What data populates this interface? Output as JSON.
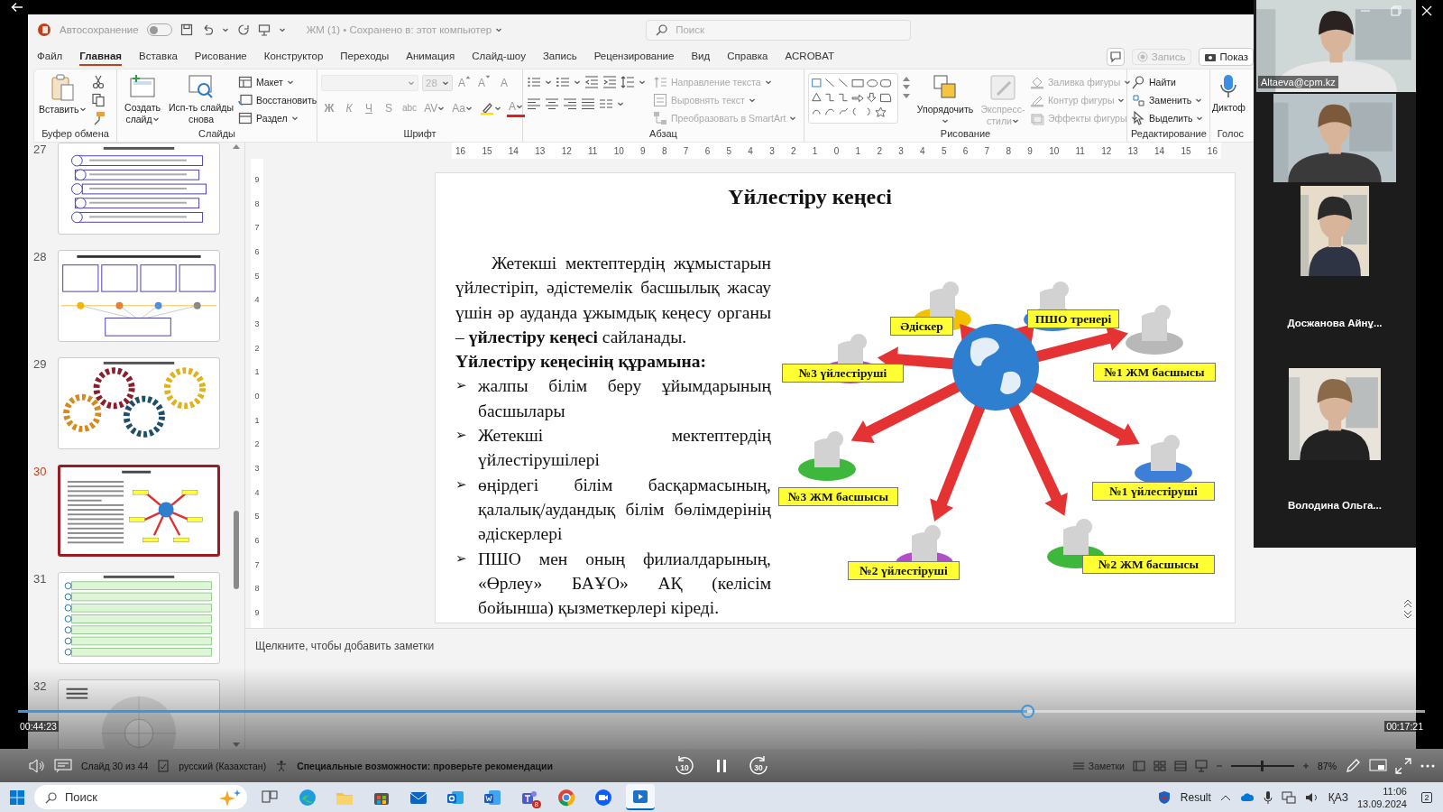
{
  "title_bar": {
    "autosave_label": "Автосохранение",
    "autosave_on": false,
    "document": "ЖМ (1) • Сохранено в: этот компьютер",
    "search_placeholder": "Поиск"
  },
  "ribbon_tabs": [
    {
      "label": "Файл",
      "selected": false
    },
    {
      "label": "Главная",
      "selected": true
    },
    {
      "label": "Вставка",
      "selected": false
    },
    {
      "label": "Рисование",
      "selected": false
    },
    {
      "label": "Конструктор",
      "selected": false
    },
    {
      "label": "Переходы",
      "selected": false
    },
    {
      "label": "Анимация",
      "selected": false
    },
    {
      "label": "Слайд-шоу",
      "selected": false
    },
    {
      "label": "Запись",
      "selected": false
    },
    {
      "label": "Рецензирование",
      "selected": false
    },
    {
      "label": "Вид",
      "selected": false
    },
    {
      "label": "Справка",
      "selected": false
    },
    {
      "label": "ACROBAT",
      "selected": false
    }
  ],
  "ribbon_right": {
    "record": {
      "label": "Запись",
      "disabled": true
    },
    "show": {
      "label": "Показ"
    }
  },
  "ribbon": {
    "clipboard": {
      "label": "Буфер обмена",
      "paste": "Вставить"
    },
    "slides": {
      "label": "Слайды",
      "new_slide": "Создать слайд",
      "reuse": "Исп-ть слайды снова",
      "items": [
        "Макет",
        "Восстановить",
        "Раздел"
      ]
    },
    "font": {
      "label": "Шрифт",
      "disabled": true,
      "size": "28",
      "row1": [
        {
          "text": "A",
          "kind": "grow"
        },
        {
          "text": "A",
          "kind": "shrink"
        },
        {
          "text": "A",
          "kind": "clear"
        }
      ],
      "row2": [
        {
          "text": "Ж",
          "kind": "bold"
        },
        {
          "text": "К",
          "kind": "italic"
        },
        {
          "text": "Ч",
          "kind": "underline"
        },
        {
          "text": "S",
          "kind": "shadow"
        },
        {
          "text": "abc",
          "kind": "strike"
        },
        {
          "text": "AV",
          "kind": "spacing"
        },
        {
          "text": "Aa",
          "kind": "case"
        },
        {
          "kind": "highlight"
        },
        {
          "text": "A",
          "kind": "color"
        }
      ]
    },
    "paragraph": {
      "label": "Абзац",
      "items": [
        {
          "label": "Направление текста",
          "disabled": true
        },
        {
          "label": "Выровнять текст",
          "disabled": true
        },
        {
          "label": "Преобразовать в SmartArt",
          "disabled": true
        }
      ]
    },
    "drawing": {
      "label": "Рисование",
      "arrange": "Упорядочить",
      "quick_styles": {
        "label": "Экспресс-стили",
        "disabled": true
      },
      "items": [
        {
          "label": "Заливка фигуры",
          "disabled": true
        },
        {
          "label": "Контур фигуры",
          "disabled": true
        },
        {
          "label": "Эффекты фигуры",
          "disabled": true
        }
      ]
    },
    "editing": {
      "label": "Редактирование",
      "items": [
        "Найти",
        "Заменить",
        "Выделить"
      ]
    },
    "voice": {
      "label": "Голос",
      "dictate": "Диктоф"
    }
  },
  "thumbnails": [
    {
      "number": "27",
      "kind": "list",
      "selected": false
    },
    {
      "number": "28",
      "kind": "timeline",
      "selected": false
    },
    {
      "number": "29",
      "kind": "gears",
      "selected": false
    },
    {
      "number": "30",
      "kind": "current",
      "selected": true
    },
    {
      "number": "31",
      "kind": "greenlist",
      "selected": false
    },
    {
      "number": "32",
      "kind": "wheel",
      "selected": false
    }
  ],
  "ruler_h": [
    "16",
    "15",
    "14",
    "13",
    "12",
    "11",
    "10",
    "9",
    "8",
    "7",
    "6",
    "5",
    "4",
    "3",
    "2",
    "1",
    "0",
    "1",
    "2",
    "3",
    "4",
    "5",
    "6",
    "7",
    "8",
    "9",
    "10",
    "11",
    "12",
    "13",
    "14",
    "15",
    "16"
  ],
  "ruler_v": [
    "9",
    "8",
    "7",
    "6",
    "5",
    "4",
    "3",
    "2",
    "1",
    "0",
    "1",
    "2",
    "3",
    "4",
    "5",
    "6",
    "7",
    "8",
    "9"
  ],
  "slide": {
    "title": "Үйлестіру кеңесі",
    "intro": "Жетекші мектептердің жұмыстарын үйлестіріп, әдістемелік басшылық жасау үшін әр ауданда ұжымдық кеңесу органы – **үйлестіру кеңесі** сайланады.",
    "subheading": "Үйлестіру кеңесінің құрамына:",
    "bullet_mark": "➢",
    "bullets": [
      "жалпы білім беру ұйымдарының басшылары",
      "Жетекші мектептердің үйлестірушілері",
      "өңірдегі білім басқармасының, қалалық/аудандық білім бөлімдерінің әдіскерлері",
      "ПШО мен оның филиалдарының, «Өрлеу» БАҰО» АҚ (келісім бойынша) қызметкерлері кіреді."
    ],
    "figure_labels": [
      "Әдіскер",
      "ПШО тренері",
      "№3 үйлестіруші",
      "№1 ЖМ басшысы",
      "№3 ЖМ басшысы",
      "№1 үйлестіруші",
      "№2 үйлестіруші",
      "№2 ЖМ басшысы"
    ]
  },
  "notes_placeholder": "Щелкните, чтобы добавить заметки",
  "player": {
    "progress": {
      "level": 0.717
    },
    "elapsed": "00:44:23",
    "remaining": "00:17:21",
    "rewind": "10",
    "forward": "30"
  },
  "status_bar": {
    "slide_counter": "Слайд 30 из 44",
    "language": "русский (Казахстан)",
    "accessibility": "Специальные возможности: проверьте рекомендации",
    "notes_button": "Заметки",
    "zoom_slider": {
      "level": 0.47
    },
    "zoom": "87%"
  },
  "participants": [
    {
      "kind": "video_label",
      "name": "Altaeva@cpm.kz"
    },
    {
      "kind": "video"
    },
    {
      "kind": "video_name",
      "name": "Досжанова Айнұ..."
    },
    {
      "kind": "video_name",
      "name": "Володина Ольга..."
    }
  ],
  "taskbar": {
    "search_placeholder": "Поиск",
    "apps": [
      {
        "selected": false
      },
      {
        "selected": false
      },
      {
        "selected": false
      },
      {
        "selected": false
      },
      {
        "selected": false
      },
      {
        "selected": false
      },
      {
        "selected": false
      },
      {
        "selected": false,
        "badge": "8"
      },
      {
        "selected": false
      },
      {
        "selected": false
      },
      {
        "selected": true
      }
    ],
    "weather": "Result",
    "language": "ҚАЗ",
    "time": "11:06",
    "date": "13.09.2024",
    "notifications": "2"
  }
}
